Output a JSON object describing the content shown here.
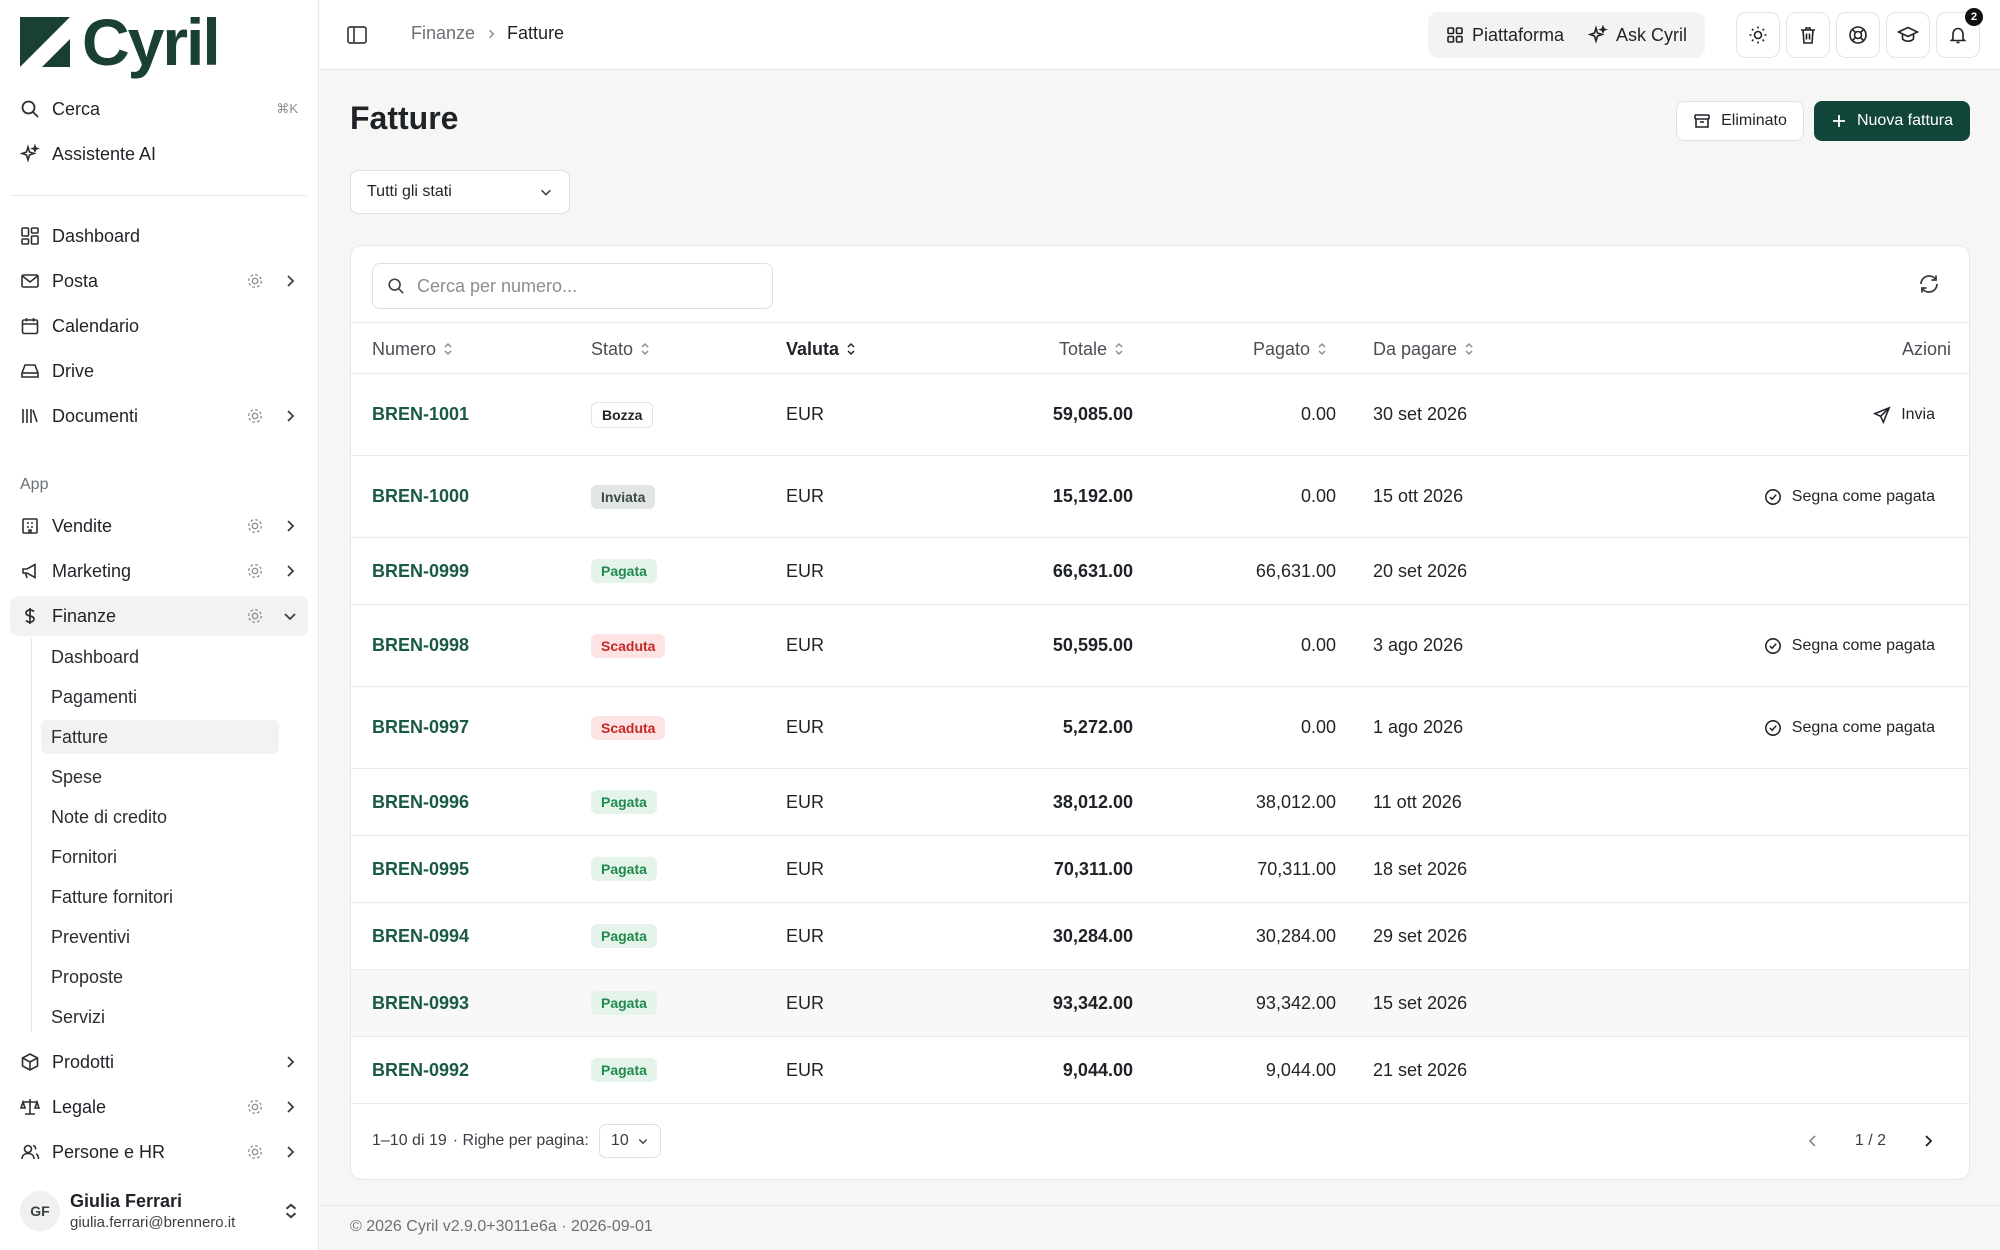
{
  "brand": {
    "name": "Cyril"
  },
  "sidebar": {
    "search": {
      "label": "Cerca",
      "shortcut": "⌘K"
    },
    "assistant": {
      "label": "Assistente AI"
    },
    "main": [
      {
        "label": "Dashboard"
      },
      {
        "label": "Posta"
      },
      {
        "label": "Calendario"
      },
      {
        "label": "Drive"
      },
      {
        "label": "Documenti"
      }
    ],
    "section_app": "App",
    "app": [
      {
        "label": "Vendite"
      },
      {
        "label": "Marketing"
      },
      {
        "label": "Finanze"
      }
    ],
    "finance_sub": [
      {
        "label": "Dashboard"
      },
      {
        "label": "Pagamenti"
      },
      {
        "label": "Fatture"
      },
      {
        "label": "Spese"
      },
      {
        "label": "Note di credito"
      },
      {
        "label": "Fornitori"
      },
      {
        "label": "Fatture fornitori"
      },
      {
        "label": "Preventivi"
      },
      {
        "label": "Proposte"
      },
      {
        "label": "Servizi"
      }
    ],
    "bottom": [
      {
        "label": "Prodotti"
      },
      {
        "label": "Legale"
      },
      {
        "label": "Persone e HR"
      }
    ],
    "user": {
      "initials": "GF",
      "name": "Giulia Ferrari",
      "email": "giulia.ferrari@brennero.it"
    }
  },
  "topbar": {
    "breadcrumb": [
      "Finanze",
      "Fatture"
    ],
    "platform_label": "Piattaforma",
    "ask_label": "Ask Cyril",
    "notifications_count": "2"
  },
  "page": {
    "title": "Fatture",
    "deleted_label": "Eliminato",
    "new_label": "Nuova fattura",
    "status_filter": "Tutti gli stati",
    "search_placeholder": "Cerca per numero..."
  },
  "table": {
    "columns": {
      "numero": "Numero",
      "stato": "Stato",
      "valuta": "Valuta",
      "totale": "Totale",
      "pagato": "Pagato",
      "da_pagare": "Da pagare",
      "azioni": "Azioni"
    },
    "rows": [
      {
        "numero": "BREN-1001",
        "stato": "Bozza",
        "valuta": "EUR",
        "totale": "59,085.00",
        "pagato": "0.00",
        "da_pagare": "30 set 2026",
        "azione": "Invia"
      },
      {
        "numero": "BREN-1000",
        "stato": "Inviata",
        "valuta": "EUR",
        "totale": "15,192.00",
        "pagato": "0.00",
        "da_pagare": "15 ott 2026",
        "azione": "Segna come pagata"
      },
      {
        "numero": "BREN-0999",
        "stato": "Pagata",
        "valuta": "EUR",
        "totale": "66,631.00",
        "pagato": "66,631.00",
        "da_pagare": "20 set 2026",
        "azione": ""
      },
      {
        "numero": "BREN-0998",
        "stato": "Scaduta",
        "valuta": "EUR",
        "totale": "50,595.00",
        "pagato": "0.00",
        "da_pagare": "3 ago 2026",
        "azione": "Segna come pagata"
      },
      {
        "numero": "BREN-0997",
        "stato": "Scaduta",
        "valuta": "EUR",
        "totale": "5,272.00",
        "pagato": "0.00",
        "da_pagare": "1 ago 2026",
        "azione": "Segna come pagata"
      },
      {
        "numero": "BREN-0996",
        "stato": "Pagata",
        "valuta": "EUR",
        "totale": "38,012.00",
        "pagato": "38,012.00",
        "da_pagare": "11 ott 2026",
        "azione": ""
      },
      {
        "numero": "BREN-0995",
        "stato": "Pagata",
        "valuta": "EUR",
        "totale": "70,311.00",
        "pagato": "70,311.00",
        "da_pagare": "18 set 2026",
        "azione": ""
      },
      {
        "numero": "BREN-0994",
        "stato": "Pagata",
        "valuta": "EUR",
        "totale": "30,284.00",
        "pagato": "30,284.00",
        "da_pagare": "29 set 2026",
        "azione": ""
      },
      {
        "numero": "BREN-0993",
        "stato": "Pagata",
        "valuta": "EUR",
        "totale": "93,342.00",
        "pagato": "93,342.00",
        "da_pagare": "15 set 2026",
        "azione": ""
      },
      {
        "numero": "BREN-0992",
        "stato": "Pagata",
        "valuta": "EUR",
        "totale": "9,044.00",
        "pagato": "9,044.00",
        "da_pagare": "21 set 2026",
        "azione": ""
      }
    ],
    "summary": "1–10 di 19",
    "rows_per_page_label": "· Righe per pagina:",
    "rows_per_page": "10",
    "page": "1 / 2"
  },
  "footer": "© 2026 Cyril v2.9.0+3011e6a · 2026-09-01",
  "colors": {
    "brand": "#12453a",
    "link": "#1a5a45",
    "paid": "#1f8a4c",
    "overdue": "#c62828"
  }
}
